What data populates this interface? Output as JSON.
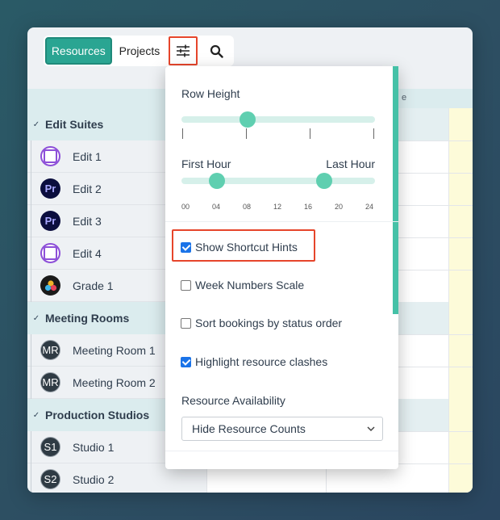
{
  "toolbar": {
    "resources_label": "Resources",
    "projects_label": "Projects",
    "filter_icon": "sliders-icon",
    "search_icon": "search-icon"
  },
  "sidebar": {
    "groups": [
      {
        "label": "Edit Suites",
        "items": [
          {
            "label": "Edit 1",
            "icon": "purple-app-icon"
          },
          {
            "label": "Edit 2",
            "icon": "premiere-icon",
            "badge": "Pr"
          },
          {
            "label": "Edit 3",
            "icon": "premiere-icon",
            "badge": "Pr"
          },
          {
            "label": "Edit 4",
            "icon": "purple-app-icon"
          },
          {
            "label": "Grade 1",
            "icon": "davinci-icon"
          }
        ]
      },
      {
        "label": "Meeting Rooms",
        "items": [
          {
            "label": "Meeting Room 1",
            "badge": "MR"
          },
          {
            "label": "Meeting Room 2",
            "badge": "MR"
          }
        ]
      },
      {
        "label": "Production Studios",
        "items": [
          {
            "label": "Studio 1",
            "badge": "S1"
          },
          {
            "label": "Studio 2",
            "badge": "S2"
          }
        ]
      }
    ]
  },
  "grid": {
    "header_fragment": "e"
  },
  "popup": {
    "row_height_label": "Row Height",
    "row_height_value_fraction": 0.34,
    "first_hour_label": "First Hour",
    "last_hour_label": "Last Hour",
    "first_hour_value": "04",
    "last_hour_value": "18",
    "hour_ticks": [
      "00",
      "04",
      "08",
      "12",
      "16",
      "20",
      "24"
    ],
    "options": [
      {
        "label": "Show Shortcut Hints",
        "checked": true
      },
      {
        "label": "Week Numbers Scale",
        "checked": false
      },
      {
        "label": "Sort bookings by status order",
        "checked": false
      },
      {
        "label": "Highlight resource clashes",
        "checked": true
      }
    ],
    "availability_label": "Resource Availability",
    "availability_value": "Hide Resource Counts"
  },
  "colors": {
    "accent": "#2aa592",
    "highlight": "#e6452b",
    "slider": "#5fcfb0",
    "checkbox": "#1a73e8"
  }
}
